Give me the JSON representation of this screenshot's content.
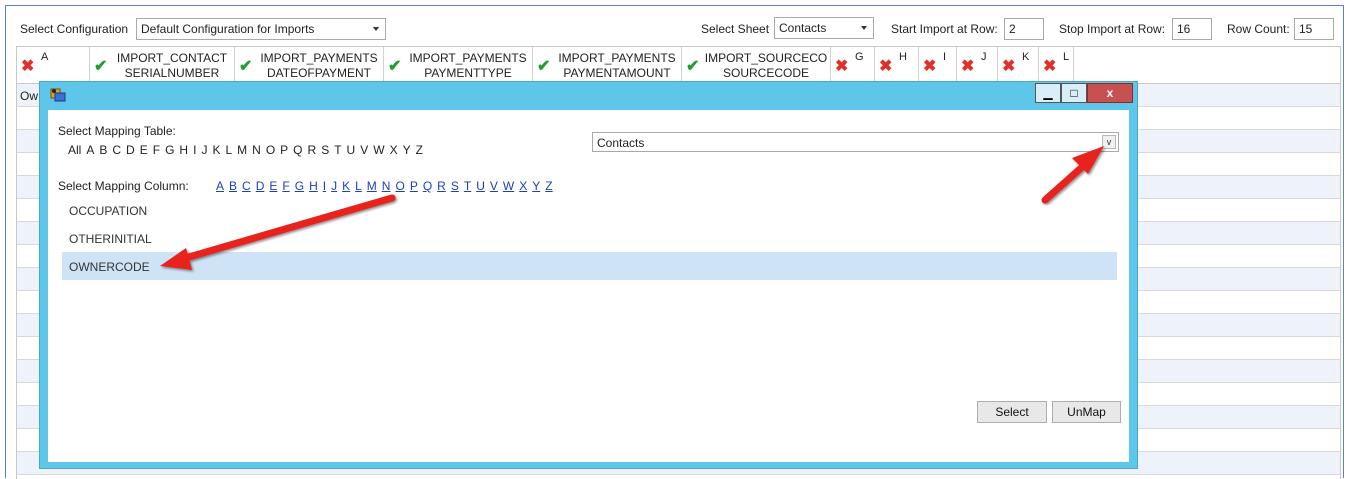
{
  "toolbar": {
    "config_label": "Select Configuration",
    "config_value": "Default Configuration for Imports",
    "sheet_label": "Select Sheet",
    "sheet_value": "Contacts",
    "start_label": "Start Import at Row:",
    "start_value": "2",
    "stop_label": "Stop Import at Row:",
    "stop_value": "16",
    "count_label": "Row Count:",
    "count_value": "15"
  },
  "grid": {
    "columns": [
      {
        "status": "unmapped",
        "letter": "A",
        "line1": "",
        "line2": ""
      },
      {
        "status": "mapped",
        "letter": "",
        "line1": "IMPORT_CONTACT",
        "line2": "SERIALNUMBER"
      },
      {
        "status": "mapped",
        "letter": "",
        "line1": "IMPORT_PAYMENTS",
        "line2": "DATEOFPAYMENT"
      },
      {
        "status": "mapped",
        "letter": "",
        "line1": "IMPORT_PAYMENTS",
        "line2": "PAYMENTTYPE"
      },
      {
        "status": "mapped",
        "letter": "",
        "line1": "IMPORT_PAYMENTS",
        "line2": "PAYMENTAMOUNT"
      },
      {
        "status": "mapped",
        "letter": "",
        "line1": "IMPORT_SOURCECO",
        "line2": "SOURCECODE"
      },
      {
        "status": "unmapped",
        "letter": "G",
        "line1": "",
        "line2": ""
      },
      {
        "status": "unmapped",
        "letter": "H",
        "line1": "",
        "line2": ""
      },
      {
        "status": "unmapped",
        "letter": "I",
        "line1": "",
        "line2": ""
      },
      {
        "status": "unmapped",
        "letter": "J",
        "line1": "",
        "line2": ""
      },
      {
        "status": "unmapped",
        "letter": "K",
        "line1": "",
        "line2": ""
      },
      {
        "status": "unmapped",
        "letter": "L",
        "line1": "",
        "line2": ""
      }
    ],
    "first_cell": "Ow"
  },
  "dialog": {
    "table_label": "Select Mapping Table:",
    "table_letters": [
      "All",
      "A",
      "B",
      "C",
      "D",
      "E",
      "F",
      "G",
      "H",
      "I",
      "J",
      "K",
      "L",
      "M",
      "N",
      "O",
      "P",
      "Q",
      "R",
      "S",
      "T",
      "U",
      "V",
      "W",
      "X",
      "Y",
      "Z"
    ],
    "table_value": "Contacts",
    "column_label": "Select Mapping Column:",
    "column_letters": [
      "A",
      "B",
      "C",
      "D",
      "E",
      "F",
      "G",
      "H",
      "I",
      "J",
      "K",
      "L",
      "M",
      "N",
      "O",
      "P",
      "Q",
      "R",
      "S",
      "T",
      "U",
      "V",
      "W",
      "X",
      "Y",
      "Z"
    ],
    "columns": [
      "OCCUPATION",
      "OTHERINITIAL",
      "OWNERCODE"
    ],
    "selected_column": "OWNERCODE",
    "select_button": "Select",
    "unmap_button": "UnMap",
    "min_glyph": "▁",
    "max_glyph": "□",
    "close_glyph": "x"
  },
  "colors": {
    "dialog_frame": "#5ec6e8",
    "selected_row": "#cfe3f6",
    "link": "#1a3fc0",
    "unmapped_icon": "#e0302a",
    "mapped_icon": "#1f9e2f",
    "annotation_arrow": "#e8201a"
  }
}
